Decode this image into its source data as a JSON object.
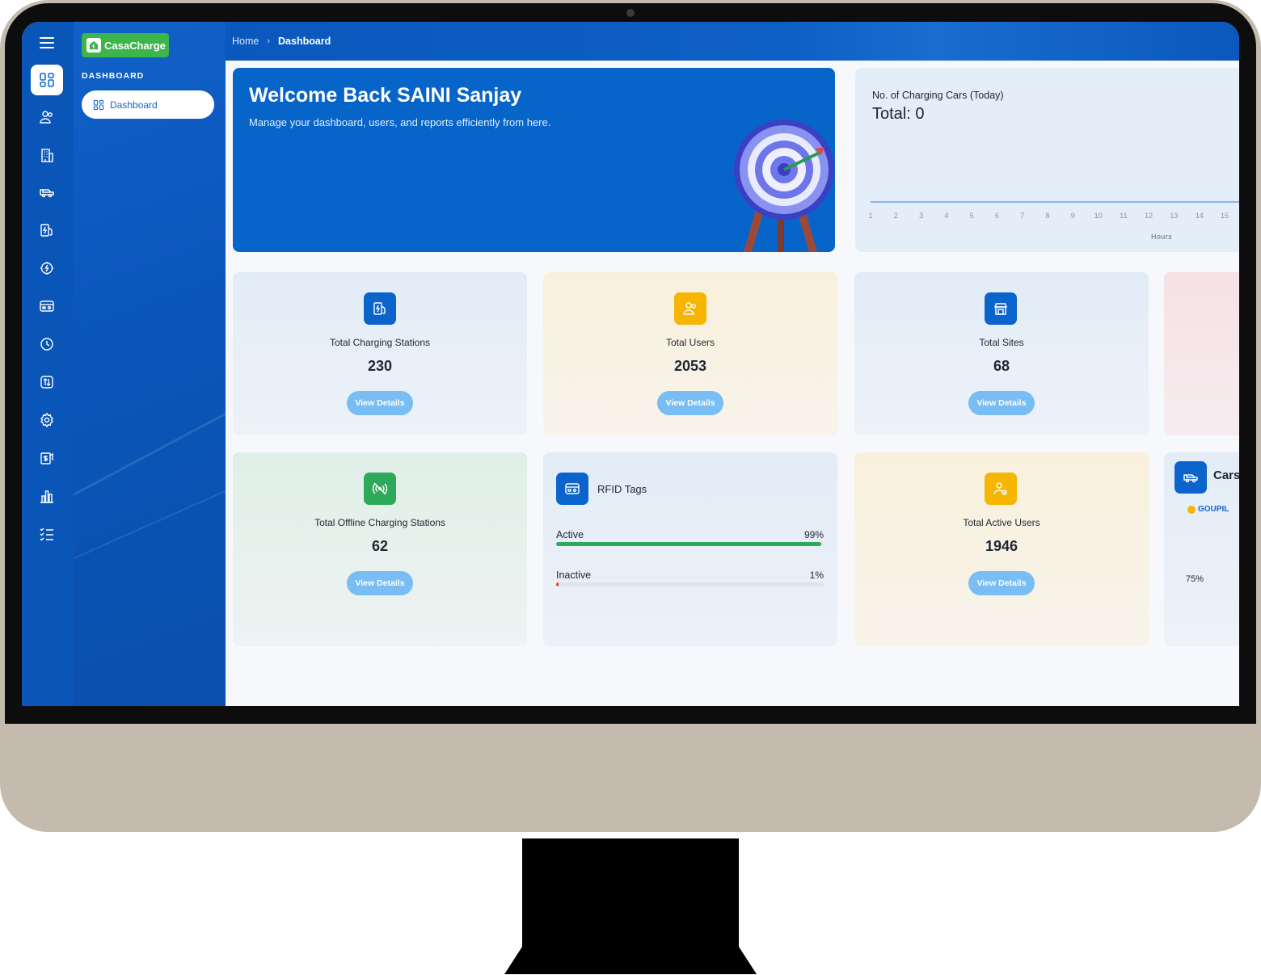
{
  "brand": {
    "name": "CasaCharge",
    "color": "#3cb54a"
  },
  "breadcrumb": {
    "home": "Home",
    "current": "Dashboard"
  },
  "sidebar": {
    "section_title": "DASHBOARD",
    "active_item": "Dashboard",
    "rail_icons": [
      "dashboard-icon",
      "users-icon",
      "building-icon",
      "car-icon",
      "charging-station-icon",
      "energy-settings-icon",
      "card-icon",
      "history-icon",
      "transfer-icon",
      "settings-icon",
      "billing-icon",
      "reports-icon",
      "checklist-icon"
    ]
  },
  "welcome": {
    "title": "Welcome Back SAINI Sanjay",
    "subtitle": "Manage your dashboard, users, and reports efficiently from here."
  },
  "charging_today": {
    "title": "No. of Charging Cars (Today)",
    "total": "Total: 0",
    "chart_data": {
      "type": "line",
      "x": [
        1,
        2,
        3,
        4,
        5,
        6,
        7,
        8,
        9,
        10,
        11,
        12,
        13,
        14,
        15
      ],
      "series": [
        {
          "values": [
            0,
            0,
            0,
            0,
            0,
            0,
            0,
            0,
            0,
            0,
            0,
            0,
            0,
            0,
            0
          ]
        }
      ],
      "xlabel": "Hours",
      "ylabel": "",
      "grid": false
    }
  },
  "stats": {
    "stations": {
      "label": "Total Charging Stations",
      "value": "230",
      "button": "View Details"
    },
    "users": {
      "label": "Total Users",
      "value": "2053",
      "button": "View Details"
    },
    "sites": {
      "label": "Total Sites",
      "value": "68",
      "button": "View Details"
    },
    "offline": {
      "label": "Total Offline Charging Stations",
      "value": "62",
      "button": "View Details"
    },
    "active_users": {
      "label": "Total Active Users",
      "value": "1946",
      "button": "View Details"
    }
  },
  "rfid": {
    "title": "RFID Tags",
    "rows": [
      {
        "label": "Active",
        "percent_text": "99%",
        "percent": 99,
        "color": "#2ea85a"
      },
      {
        "label": "Inactive",
        "percent_text": "1%",
        "percent": 1,
        "color": "#e53935"
      }
    ]
  },
  "cars": {
    "title": "Cars",
    "legend": "GOUPIL",
    "legend_color": "#f5b500",
    "percent_label": "75%"
  },
  "colors": {
    "primary": "#0764c9",
    "accent_yellow": "#f5b500",
    "accent_green": "#2ea85a",
    "button": "#78bdf4"
  }
}
